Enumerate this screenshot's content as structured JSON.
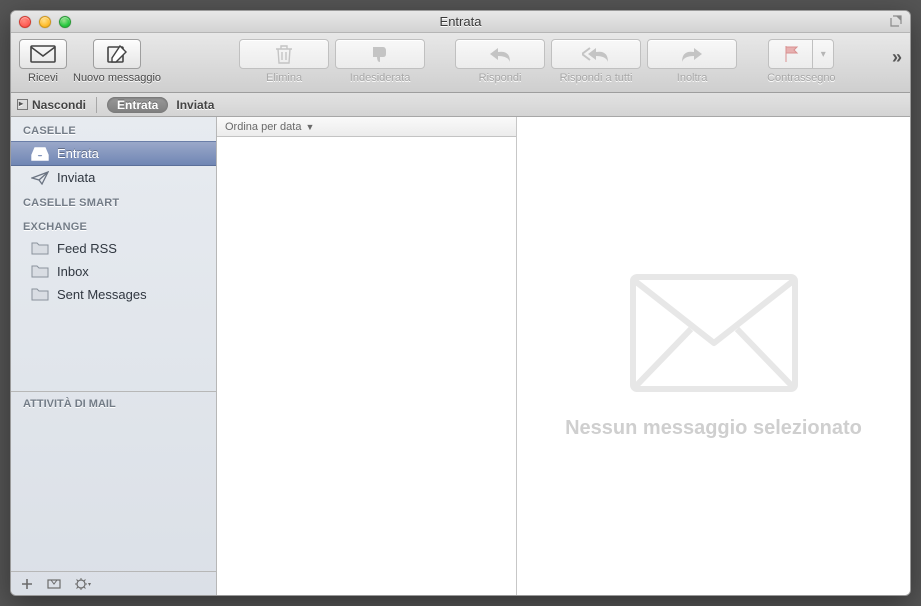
{
  "window": {
    "title": "Entrata"
  },
  "toolbar": {
    "receive": "Ricevi",
    "new_message": "Nuovo messaggio",
    "delete": "Elimina",
    "junk": "Indesiderata",
    "reply": "Rispondi",
    "reply_all": "Rispondi a tutti",
    "forward": "Inoltra",
    "flag": "Contrassegno"
  },
  "favbar": {
    "hide": "Nascondi",
    "inbox": "Entrata",
    "sent": "Inviata"
  },
  "sidebar": {
    "mailboxes_header": "CASELLE",
    "inbox": "Entrata",
    "sent": "Inviata",
    "smart_header": "CASELLE SMART",
    "exchange_header": "EXCHANGE",
    "feed": "Feed RSS",
    "inbox_en": "Inbox",
    "sent_messages": "Sent Messages",
    "activity_header": "ATTIVITÀ DI MAIL"
  },
  "mlist": {
    "sort_label": "Ordina per data"
  },
  "preview": {
    "empty": "Nessun messaggio selezionato"
  }
}
